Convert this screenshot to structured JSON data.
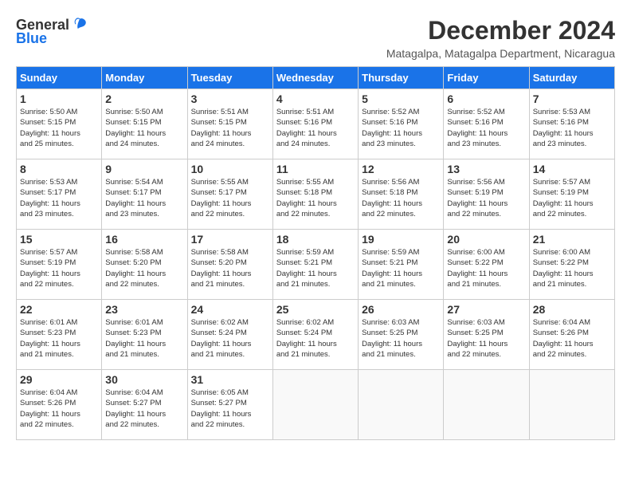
{
  "header": {
    "logo_general": "General",
    "logo_blue": "Blue",
    "month_title": "December 2024",
    "location": "Matagalpa, Matagalpa Department, Nicaragua"
  },
  "calendar": {
    "days_of_week": [
      "Sunday",
      "Monday",
      "Tuesday",
      "Wednesday",
      "Thursday",
      "Friday",
      "Saturday"
    ],
    "weeks": [
      [
        {
          "day": "",
          "text": ""
        },
        {
          "day": "2",
          "text": "Sunrise: 5:50 AM\nSunset: 5:15 PM\nDaylight: 11 hours\nand 24 minutes."
        },
        {
          "day": "3",
          "text": "Sunrise: 5:51 AM\nSunset: 5:15 PM\nDaylight: 11 hours\nand 24 minutes."
        },
        {
          "day": "4",
          "text": "Sunrise: 5:51 AM\nSunset: 5:16 PM\nDaylight: 11 hours\nand 24 minutes."
        },
        {
          "day": "5",
          "text": "Sunrise: 5:52 AM\nSunset: 5:16 PM\nDaylight: 11 hours\nand 23 minutes."
        },
        {
          "day": "6",
          "text": "Sunrise: 5:52 AM\nSunset: 5:16 PM\nDaylight: 11 hours\nand 23 minutes."
        },
        {
          "day": "7",
          "text": "Sunrise: 5:53 AM\nSunset: 5:16 PM\nDaylight: 11 hours\nand 23 minutes."
        }
      ],
      [
        {
          "day": "1",
          "text": "Sunrise: 5:50 AM\nSunset: 5:15 PM\nDaylight: 11 hours\nand 25 minutes."
        },
        {
          "day": "9",
          "text": "Sunrise: 5:54 AM\nSunset: 5:17 PM\nDaylight: 11 hours\nand 23 minutes."
        },
        {
          "day": "10",
          "text": "Sunrise: 5:55 AM\nSunset: 5:17 PM\nDaylight: 11 hours\nand 22 minutes."
        },
        {
          "day": "11",
          "text": "Sunrise: 5:55 AM\nSunset: 5:18 PM\nDaylight: 11 hours\nand 22 minutes."
        },
        {
          "day": "12",
          "text": "Sunrise: 5:56 AM\nSunset: 5:18 PM\nDaylight: 11 hours\nand 22 minutes."
        },
        {
          "day": "13",
          "text": "Sunrise: 5:56 AM\nSunset: 5:19 PM\nDaylight: 11 hours\nand 22 minutes."
        },
        {
          "day": "14",
          "text": "Sunrise: 5:57 AM\nSunset: 5:19 PM\nDaylight: 11 hours\nand 22 minutes."
        }
      ],
      [
        {
          "day": "8",
          "text": "Sunrise: 5:53 AM\nSunset: 5:17 PM\nDaylight: 11 hours\nand 23 minutes."
        },
        {
          "day": "16",
          "text": "Sunrise: 5:58 AM\nSunset: 5:20 PM\nDaylight: 11 hours\nand 22 minutes."
        },
        {
          "day": "17",
          "text": "Sunrise: 5:58 AM\nSunset: 5:20 PM\nDaylight: 11 hours\nand 21 minutes."
        },
        {
          "day": "18",
          "text": "Sunrise: 5:59 AM\nSunset: 5:21 PM\nDaylight: 11 hours\nand 21 minutes."
        },
        {
          "day": "19",
          "text": "Sunrise: 5:59 AM\nSunset: 5:21 PM\nDaylight: 11 hours\nand 21 minutes."
        },
        {
          "day": "20",
          "text": "Sunrise: 6:00 AM\nSunset: 5:22 PM\nDaylight: 11 hours\nand 21 minutes."
        },
        {
          "day": "21",
          "text": "Sunrise: 6:00 AM\nSunset: 5:22 PM\nDaylight: 11 hours\nand 21 minutes."
        }
      ],
      [
        {
          "day": "15",
          "text": "Sunrise: 5:57 AM\nSunset: 5:19 PM\nDaylight: 11 hours\nand 22 minutes."
        },
        {
          "day": "23",
          "text": "Sunrise: 6:01 AM\nSunset: 5:23 PM\nDaylight: 11 hours\nand 21 minutes."
        },
        {
          "day": "24",
          "text": "Sunrise: 6:02 AM\nSunset: 5:24 PM\nDaylight: 11 hours\nand 21 minutes."
        },
        {
          "day": "25",
          "text": "Sunrise: 6:02 AM\nSunset: 5:24 PM\nDaylight: 11 hours\nand 21 minutes."
        },
        {
          "day": "26",
          "text": "Sunrise: 6:03 AM\nSunset: 5:25 PM\nDaylight: 11 hours\nand 21 minutes."
        },
        {
          "day": "27",
          "text": "Sunrise: 6:03 AM\nSunset: 5:25 PM\nDaylight: 11 hours\nand 22 minutes."
        },
        {
          "day": "28",
          "text": "Sunrise: 6:04 AM\nSunset: 5:26 PM\nDaylight: 11 hours\nand 22 minutes."
        }
      ],
      [
        {
          "day": "22",
          "text": "Sunrise: 6:01 AM\nSunset: 5:23 PM\nDaylight: 11 hours\nand 21 minutes."
        },
        {
          "day": "30",
          "text": "Sunrise: 6:04 AM\nSunset: 5:27 PM\nDaylight: 11 hours\nand 22 minutes."
        },
        {
          "day": "31",
          "text": "Sunrise: 6:05 AM\nSunset: 5:27 PM\nDaylight: 11 hours\nand 22 minutes."
        },
        {
          "day": "",
          "text": ""
        },
        {
          "day": "",
          "text": ""
        },
        {
          "day": "",
          "text": ""
        },
        {
          "day": "",
          "text": ""
        }
      ],
      [
        {
          "day": "29",
          "text": "Sunrise: 6:04 AM\nSunset: 5:26 PM\nDaylight: 11 hours\nand 22 minutes."
        },
        {
          "day": "",
          "text": ""
        },
        {
          "day": "",
          "text": ""
        },
        {
          "day": "",
          "text": ""
        },
        {
          "day": "",
          "text": ""
        },
        {
          "day": "",
          "text": ""
        },
        {
          "day": "",
          "text": ""
        }
      ]
    ]
  }
}
